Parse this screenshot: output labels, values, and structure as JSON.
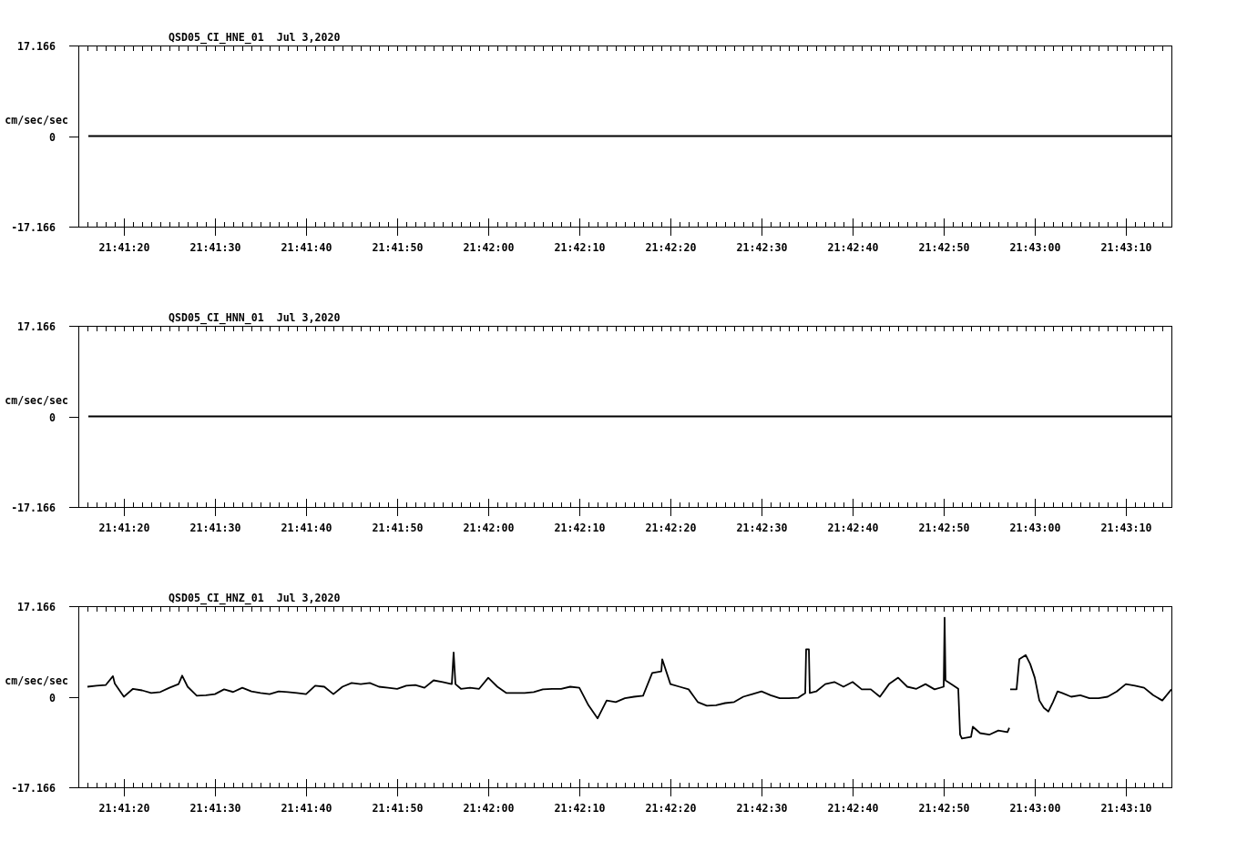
{
  "panels": [
    {
      "chart_data": {
        "type": "line",
        "title": "QSD05_CI_HNE_01  Jul 3,2020",
        "ylabel": "cm/sec/sec",
        "xlim": [
          78075,
          78195
        ],
        "ylim": [
          -17.166,
          17.166
        ],
        "yticks": [
          17.166,
          0,
          -17.166
        ],
        "xticks": [
          {
            "value": 78080,
            "label": "21:41:20"
          },
          {
            "value": 78090,
            "label": "21:41:30"
          },
          {
            "value": 78100,
            "label": "21:41:40"
          },
          {
            "value": 78110,
            "label": "21:41:50"
          },
          {
            "value": 78120,
            "label": "21:42:00"
          },
          {
            "value": 78130,
            "label": "21:42:10"
          },
          {
            "value": 78140,
            "label": "21:42:20"
          },
          {
            "value": 78150,
            "label": "21:42:30"
          },
          {
            "value": 78160,
            "label": "21:42:40"
          },
          {
            "value": 78170,
            "label": "21:42:50"
          },
          {
            "value": 78180,
            "label": "21:43:00"
          },
          {
            "value": 78190,
            "label": "21:43:10"
          }
        ],
        "x": [
          78076.1,
          78080,
          78090,
          78100,
          78110,
          78120,
          78130,
          78140,
          78150,
          78160,
          78170,
          78180,
          78190,
          78195
        ],
        "values": [
          0,
          0,
          0,
          0,
          0,
          0,
          0,
          0,
          0,
          0,
          0,
          0,
          0,
          0
        ]
      }
    },
    {
      "chart_data": {
        "type": "line",
        "title": "QSD05_CI_HNN_01  Jul 3,2020",
        "ylabel": "cm/sec/sec",
        "xlim": [
          78075,
          78195
        ],
        "ylim": [
          -17.166,
          17.166
        ],
        "yticks": [
          17.166,
          0,
          -17.166
        ],
        "xticks": [
          {
            "value": 78080,
            "label": "21:41:20"
          },
          {
            "value": 78090,
            "label": "21:41:30"
          },
          {
            "value": 78100,
            "label": "21:41:40"
          },
          {
            "value": 78110,
            "label": "21:41:50"
          },
          {
            "value": 78120,
            "label": "21:42:00"
          },
          {
            "value": 78130,
            "label": "21:42:10"
          },
          {
            "value": 78140,
            "label": "21:42:20"
          },
          {
            "value": 78150,
            "label": "21:42:30"
          },
          {
            "value": 78160,
            "label": "21:42:40"
          },
          {
            "value": 78170,
            "label": "21:42:50"
          },
          {
            "value": 78180,
            "label": "21:43:00"
          },
          {
            "value": 78190,
            "label": "21:43:10"
          }
        ],
        "x": [
          78076.1,
          78080,
          78090,
          78100,
          78110,
          78120,
          78130,
          78140,
          78150,
          78160,
          78170,
          78180,
          78190,
          78195
        ],
        "values": [
          0,
          0,
          0,
          0,
          0,
          0,
          0,
          0,
          0,
          0,
          0,
          0,
          0,
          0
        ]
      }
    },
    {
      "chart_data": {
        "type": "line",
        "title": "QSD05_CI_HNZ_01  Jul 3,2020",
        "ylabel": "cm/sec/sec",
        "xlim": [
          78075,
          78195
        ],
        "ylim": [
          -17.166,
          17.166
        ],
        "yticks": [
          17.166,
          0,
          -17.166
        ],
        "xticks": [
          {
            "value": 78080,
            "label": "21:41:20"
          },
          {
            "value": 78090,
            "label": "21:41:30"
          },
          {
            "value": 78100,
            "label": "21:41:40"
          },
          {
            "value": 78110,
            "label": "21:41:50"
          },
          {
            "value": 78120,
            "label": "21:42:00"
          },
          {
            "value": 78130,
            "label": "21:42:10"
          },
          {
            "value": 78140,
            "label": "21:42:20"
          },
          {
            "value": 78150,
            "label": "21:42:30"
          },
          {
            "value": 78160,
            "label": "21:42:40"
          },
          {
            "value": 78170,
            "label": "21:42:50"
          },
          {
            "value": 78180,
            "label": "21:43:00"
          },
          {
            "value": 78190,
            "label": "21:43:10"
          }
        ],
        "x": [
          78076,
          78077,
          78078,
          78078.8,
          78079,
          78080,
          78081,
          78082,
          78083,
          78084,
          78085,
          78086,
          78086.4,
          78087,
          78088,
          78089,
          78090,
          78091,
          78092,
          78093,
          78094,
          78095,
          78096,
          78097,
          78098,
          78099,
          78100,
          78101,
          78102,
          78103,
          78104,
          78105,
          78106,
          78107,
          78108,
          78109,
          78110,
          78111,
          78112,
          78113,
          78114,
          78115,
          78116,
          78116.2,
          78116.4,
          78117,
          78118,
          78119,
          78120,
          78121,
          78122,
          78123,
          78124,
          78125,
          78126,
          78127,
          78128,
          78129,
          78130,
          78131,
          78132,
          78133,
          78134,
          78135,
          78136,
          78137,
          78138,
          78139,
          78139.1,
          78140,
          78141,
          78142,
          78143,
          78144,
          78145,
          78146,
          78147,
          78148,
          78149,
          78150,
          78151,
          78152,
          78153,
          78154,
          78154.8,
          78154.9,
          78155.2,
          78155.3,
          78156,
          78157,
          78158,
          78159,
          78160,
          78161,
          78162,
          78163,
          78164,
          78165,
          78166,
          78167,
          78168,
          78169,
          78170,
          78170.1,
          78170.2,
          78171,
          78171.6,
          78171.8,
          78172,
          78173,
          78173.2,
          78174,
          78175,
          78176,
          78177,
          78177.2,
          78177.25,
          78177.3,
          78178,
          78178.3,
          78179,
          78179.5,
          78180,
          78180.5,
          78181,
          78181.5,
          78182,
          78182.5,
          78183,
          78184,
          78185,
          78186,
          78187,
          78188,
          78189,
          78190,
          78191,
          78192,
          78193,
          78194,
          78195
        ],
        "values": [
          1.9,
          2.1,
          2.2,
          3.9,
          2.5,
          0,
          1.5,
          1.2,
          0.7,
          0.9,
          1.7,
          2.4,
          4.0,
          1.9,
          0.2,
          0.3,
          0.5,
          1.4,
          0.9,
          1.7,
          1.0,
          0.7,
          0.5,
          1.0,
          0.9,
          0.7,
          0.5,
          2.1,
          1.9,
          0.5,
          1.9,
          2.6,
          2.4,
          2.6,
          1.9,
          1.7,
          1.5,
          2.1,
          2.2,
          1.7,
          3.1,
          2.8,
          2.4,
          8.4,
          2.4,
          1.5,
          1.7,
          1.5,
          3.6,
          1.9,
          0.7,
          0.7,
          0.7,
          0.9,
          1.4,
          1.5,
          1.5,
          1.9,
          1.7,
          -1.6,
          -4.1,
          -0.7,
          -1.0,
          -0.3,
          0,
          0.2,
          4.5,
          4.8,
          7.1,
          2.4,
          1.9,
          1.4,
          -1.0,
          -1.7,
          -1.6,
          -1.2,
          -1.0,
          0,
          0.5,
          1.0,
          0.3,
          -0.3,
          -0.3,
          -0.2,
          0.7,
          9.0,
          9.0,
          0.7,
          1.0,
          2.4,
          2.8,
          1.9,
          2.8,
          1.4,
          1.4,
          0,
          2.4,
          3.6,
          1.9,
          1.5,
          2.4,
          1.4,
          1.9,
          15.0,
          3.1,
          2.2,
          1.5,
          -7.2,
          -7.9,
          -7.6,
          -5.7,
          -6.9,
          -7.2,
          -6.4,
          -6.7,
          -5.9,
          null,
          1.4,
          1.4,
          7.1,
          7.9,
          6.2,
          3.6,
          -0.7,
          -2.1,
          -2.8,
          -1.0,
          1.0,
          0.7,
          0,
          0.3,
          -0.3,
          -0.3,
          0,
          1.0,
          2.4,
          2.1,
          1.7,
          0.3,
          -0.7,
          1.4
        ]
      }
    }
  ]
}
